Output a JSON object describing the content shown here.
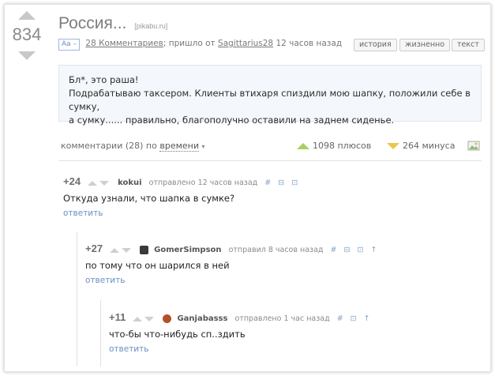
{
  "post": {
    "rating": "834",
    "title": "Россия...",
    "source": "[pikabu.ru]",
    "aa_label": "Aa –",
    "comments_link": "28 Комментариев",
    "came_from": "; пришло от",
    "author": "Sagittarius28",
    "time_ago": "12 часов назад",
    "tags": [
      "история",
      "жизненно",
      "текст"
    ],
    "story_lines": [
      "Бл*, это раша!",
      "Подрабатываю таксером. Клиенты втихаря спиздили мою шапку, положили себе в сумку,",
      "а сумку...... правильно, благополучно оставили на заднем сиденье."
    ]
  },
  "comments_bar": {
    "label": "комментарии (28) по",
    "sort_by": "времени",
    "caret": "▾",
    "pluses": "1098 плюсов",
    "minuses": "264 минуса"
  },
  "comments": [
    {
      "score": "+24",
      "user": "kokui",
      "action": "отправлено 12 часов назад",
      "tools": "# ⊟ ⊡",
      "text": "Откуда узнали, что шапка в сумке?",
      "reply": "ответить"
    },
    {
      "score": "+27",
      "user": "GomerSimpson",
      "action": "отправил 8 часов назад",
      "tools": "# ⊟ ⊡ ↑",
      "text": "по тому что он шарился в ней",
      "reply": "ответить",
      "avatar_color": "#3a3a3a"
    },
    {
      "score": "+11",
      "user": "Ganjabasss",
      "action": "отправлено 1 час назад",
      "tools": "# ⊡ ↑",
      "text": "что-бы что-нибудь сп..здить",
      "reply": "ответить",
      "avatar_color": "#b5502a"
    }
  ],
  "colors": {
    "plus": "#a8cf62",
    "minus": "#e6c94a",
    "link": "#6a8fc4"
  }
}
